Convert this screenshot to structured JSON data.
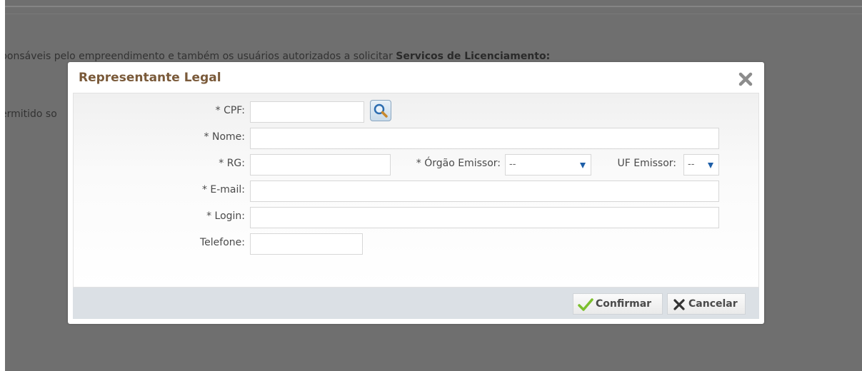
{
  "background": {
    "line1_prefix": "ponsáveis pelo empreendimento e também os usuários autorizados a solicitar ",
    "line1_bold": "Servicos de Licenciamento:",
    "line2": "ermitido so"
  },
  "dialog": {
    "title": "Representante Legal",
    "fields": {
      "cpf": {
        "label": "* CPF:",
        "value": ""
      },
      "nome": {
        "label": "* Nome:",
        "value": ""
      },
      "rg": {
        "label": "* RG:",
        "value": ""
      },
      "orgao_emissor": {
        "label": "* Órgão Emissor:",
        "selected": "--"
      },
      "uf_emissor": {
        "label": "UF Emissor:",
        "selected": "--"
      },
      "email": {
        "label": "* E-mail:",
        "value": ""
      },
      "login": {
        "label": "* Login:",
        "value": ""
      },
      "telefone": {
        "label": "Telefone:",
        "value": ""
      }
    },
    "buttons": {
      "confirm_label": "Confirmar",
      "cancel_label": "Cancelar"
    }
  },
  "colors": {
    "title": "#7a5a3a",
    "overlay": "#6f6f6f",
    "footer": "#dbe0e5",
    "select_arrow": "#1f5fa8",
    "check_icon": "#7cbf2e"
  },
  "icons": {
    "close": "close-x-icon",
    "search": "magnifier-icon",
    "confirm": "checkmark-icon",
    "cancel": "x-icon"
  }
}
